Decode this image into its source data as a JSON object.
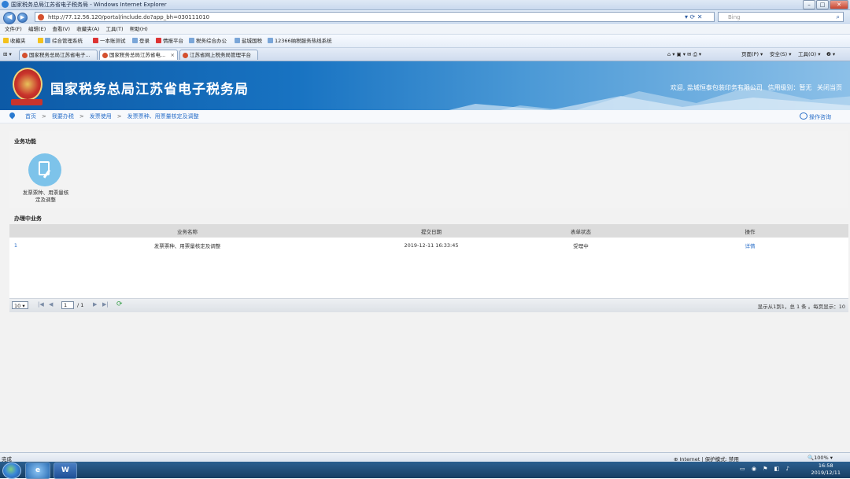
{
  "window": {
    "title": "国家税务总局江苏省电子税务局 - Windows Internet Explorer",
    "minimize": "–",
    "maximize": "□",
    "close": "✕"
  },
  "address": {
    "url": "http://77.12.56.120/portal/include.do?app_bh=030111010",
    "search_placeholder": "Bing"
  },
  "menu": [
    "文件(F)",
    "编辑(E)",
    "查看(V)",
    "收藏夹(A)",
    "工具(T)",
    "帮助(H)"
  ],
  "favorites": {
    "label": "收藏夹",
    "items": [
      "综合管理系统",
      "一本账测试",
      "登录",
      "情报平台",
      "税务综合办公",
      "盐城国税",
      "12366纳税服务热线系统"
    ]
  },
  "tabs": [
    {
      "label": "国家税务总局江苏省电子..."
    },
    {
      "label": "国家税务总局江苏省电..."
    },
    {
      "label": "江苏省网上税务局管理平台"
    }
  ],
  "command_bar": {
    "page": "页面(P) ▾",
    "safety": "安全(S) ▾",
    "tools": "工具(O) ▾",
    "help": "❷ ▾"
  },
  "site": {
    "title": "国家税务总局江苏省电子税务局",
    "welcome": "欢迎, 盐城恒泰包装印务有限公司",
    "credit": "信用级别：暂无",
    "close_page": "关闭当页"
  },
  "breadcrumb": [
    "首页",
    "我要办税",
    "发票使用",
    "发票票种、用票量核定及调整"
  ],
  "help_label": "操作咨询",
  "functions": {
    "title": "业务功能",
    "items": [
      {
        "label": "发票票种、用票量核定及调整"
      }
    ]
  },
  "in_progress": {
    "title": "办理中业务",
    "columns": [
      "业务名称",
      "提交日期",
      "表单状态",
      "操作"
    ],
    "rows": [
      {
        "index": "1",
        "name": "发票票种、用票量核定及调整",
        "date": "2019-12-11 16:33:45",
        "status": "受理中",
        "action": "详情"
      }
    ]
  },
  "pager": {
    "page_size": "10",
    "current_page": "1",
    "total_pages": "/ 1",
    "info": "显示从1到1，总 1 条 。每页显示：10"
  },
  "statusbar": {
    "left": "完成",
    "zone": "Internet | 保护模式: 禁用",
    "zoom": "100%"
  },
  "taskbar": {
    "time": "16:58",
    "date": "2019/12/11"
  }
}
